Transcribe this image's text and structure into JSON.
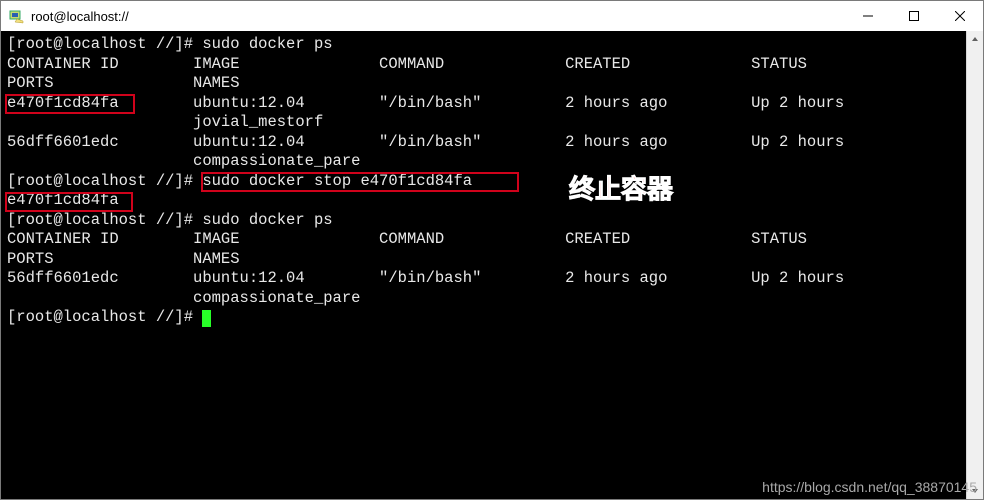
{
  "window": {
    "title": "root@localhost://"
  },
  "term": {
    "prompt1": "[root@localhost //]# ",
    "cmd_ps1": "sudo docker ps",
    "hdr_id": "CONTAINER ID",
    "hdr_image": "IMAGE",
    "hdr_cmd": "COMMAND",
    "hdr_created": "CREATED",
    "hdr_status": "STATUS",
    "hdr_ports": "PORTS",
    "hdr_names": "NAMES",
    "r1_id": "e470f1cd84fa",
    "r1_image": "ubuntu:12.04",
    "r1_cmd": "\"/bin/bash\"",
    "r1_created": "2 hours ago",
    "r1_status": "Up 2 hours",
    "r1_name": "jovial_mestorf",
    "r2_id": "56dff6601edc",
    "r2_image": "ubuntu:12.04",
    "r2_cmd": "\"/bin/bash\"",
    "r2_created": "2 hours ago",
    "r2_status": "Up 2 hours",
    "r2_name": "compassionate_pare",
    "prompt2": "[root@localhost //]# ",
    "cmd_stop": "sudo docker stop e470f1cd84fa",
    "stop_out": "e470f1cd84fa",
    "prompt3": "[root@localhost //]# ",
    "cmd_ps2": "sudo docker ps",
    "r3_id": "56dff6601edc",
    "r3_image": "ubuntu:12.04",
    "r3_cmd": "\"/bin/bash\"",
    "r3_created": "2 hours ago",
    "r3_status": "Up 2 hours",
    "r3_name": "compassionate_pare",
    "prompt4": "[root@localhost //]# "
  },
  "annotation": {
    "label": "终止容器"
  },
  "watermark": {
    "text": "https://blog.csdn.net/qq_38870145"
  },
  "cols": {
    "id": 0,
    "image": 20,
    "cmd": 40,
    "created": 60,
    "status": 80
  }
}
